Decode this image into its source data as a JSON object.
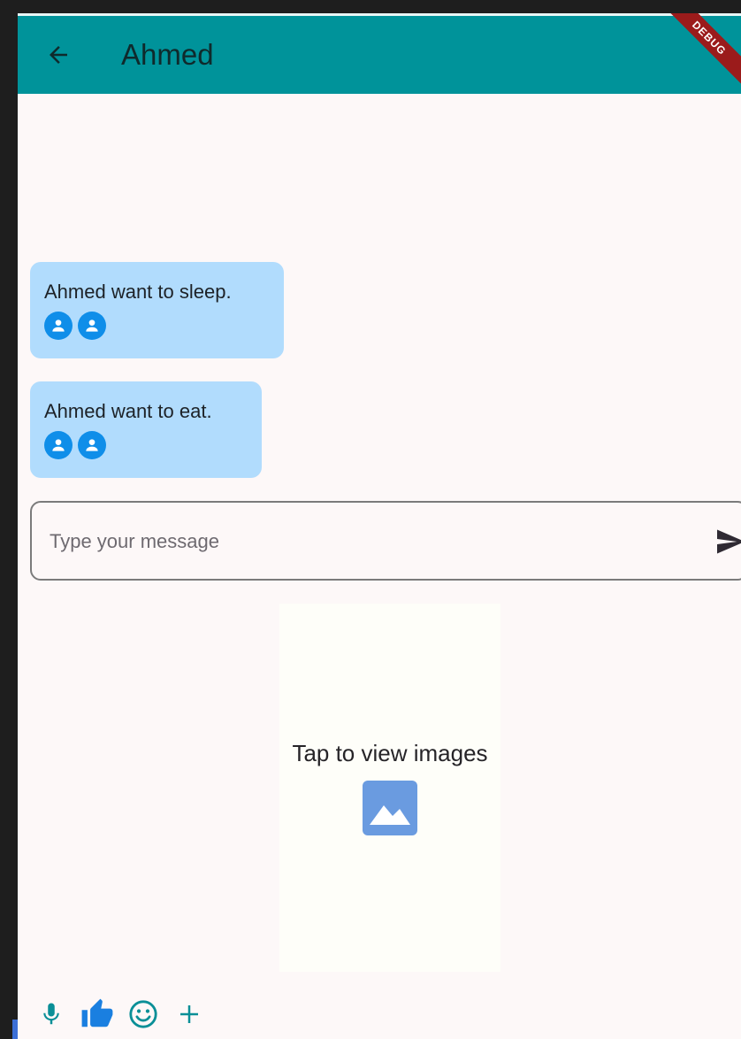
{
  "appbar": {
    "title": "Ahmed",
    "debug_label": "DEBUG"
  },
  "messages": [
    {
      "text": "Ahmed want to sleep.",
      "avatar_icon": "person-icon"
    },
    {
      "text": "Ahmed want to eat.",
      "avatar_icon": "person-icon"
    }
  ],
  "composer": {
    "placeholder": "Type your message",
    "value": ""
  },
  "image_panel": {
    "label": "Tap to view images",
    "icon": "image-icon"
  },
  "toolbar": {
    "icons": [
      "mic-icon",
      "thumbs-up-icon",
      "emoji-icon",
      "plus-icon"
    ]
  },
  "colors": {
    "appbar": "#00939a",
    "bubble": "#b1dcfd",
    "avatar": "#0f8ee9",
    "toolbar_icon": "#0a8f97",
    "image_icon": "#6a9be0"
  }
}
